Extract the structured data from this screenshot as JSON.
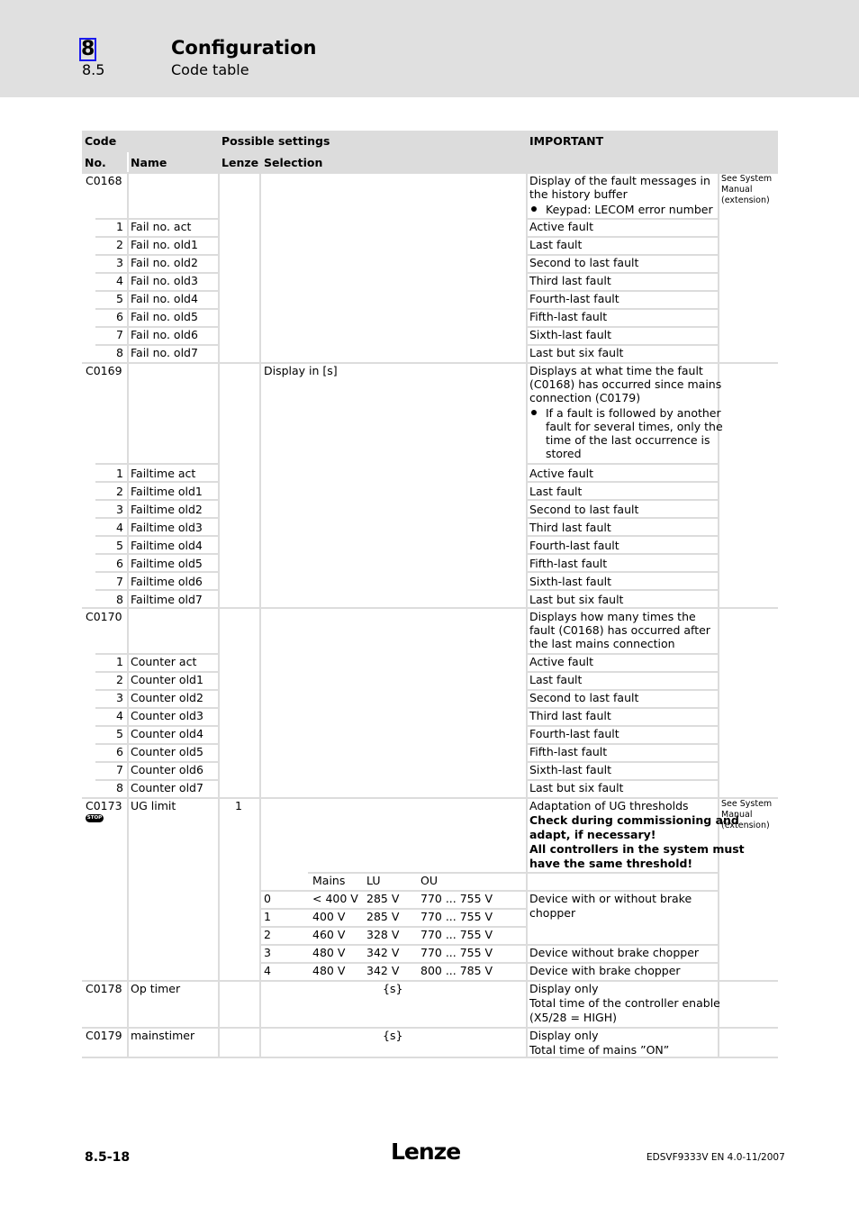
{
  "header": {
    "chapter_number": "8",
    "chapter_title": "Configuration",
    "section_number": "8.5",
    "section_title": "Code table"
  },
  "table": {
    "headers": {
      "code": "Code",
      "possible_settings": "Possible settings",
      "important": "IMPORTANT",
      "no": "No.",
      "name": "Name",
      "lenze": "Lenze",
      "selection": "Selection"
    },
    "see_system_manual": "See System Manual (extension)",
    "see_lines": [
      "See System",
      "Manual",
      "(extension)"
    ],
    "fault_labels": [
      "Active fault",
      "Last fault",
      "Second to last fault",
      "Third last fault",
      "Fourth-last fault",
      "Fifth-last fault",
      "Sixth-last fault",
      "Last but six fault"
    ],
    "c0168": {
      "code": "C0168",
      "desc_lines": [
        "Display of the fault messages in",
        "the history buffer"
      ],
      "bullet": "Keypad: LECOM error number",
      "subcodes": [
        {
          "no": "1",
          "name": "Fail no. act"
        },
        {
          "no": "2",
          "name": "Fail no. old1"
        },
        {
          "no": "3",
          "name": "Fail no. old2"
        },
        {
          "no": "4",
          "name": "Fail no. old3"
        },
        {
          "no": "5",
          "name": "Fail no. old4"
        },
        {
          "no": "6",
          "name": "Fail no. old5"
        },
        {
          "no": "7",
          "name": "Fail no. old6"
        },
        {
          "no": "8",
          "name": "Fail no. old7"
        }
      ]
    },
    "c0169": {
      "code": "C0169",
      "selection": "Display in [s]",
      "desc_lines": [
        "Displays at what time the fault",
        "(C0168) has occurred since mains",
        "connection (C0179)"
      ],
      "bullet_lines": [
        "If a fault is followed by another",
        "fault for several times, only the",
        "time of the last occurrence is",
        "stored"
      ],
      "subcodes": [
        {
          "no": "1",
          "name": "Failtime act"
        },
        {
          "no": "2",
          "name": "Failtime old1"
        },
        {
          "no": "3",
          "name": "Failtime old2"
        },
        {
          "no": "4",
          "name": "Failtime old3"
        },
        {
          "no": "5",
          "name": "Failtime old4"
        },
        {
          "no": "6",
          "name": "Failtime old5"
        },
        {
          "no": "7",
          "name": "Failtime old6"
        },
        {
          "no": "8",
          "name": "Failtime old7"
        }
      ]
    },
    "c0170": {
      "code": "C0170",
      "desc_lines": [
        "Displays how many times the",
        "fault (C0168) has occurred after",
        "the last mains connection"
      ],
      "subcodes": [
        {
          "no": "1",
          "name": "Counter act"
        },
        {
          "no": "2",
          "name": "Counter old1"
        },
        {
          "no": "3",
          "name": "Counter old2"
        },
        {
          "no": "4",
          "name": "Counter old3"
        },
        {
          "no": "5",
          "name": "Counter old4"
        },
        {
          "no": "6",
          "name": "Counter old5"
        },
        {
          "no": "7",
          "name": "Counter old6"
        },
        {
          "no": "8",
          "name": "Counter old7"
        }
      ]
    },
    "c0173": {
      "code": "C0173",
      "stop_badge": "STOP",
      "name": "UG limit",
      "lenze": "1",
      "desc": "Adaptation of UG thresholds",
      "bold_lines": [
        "Check during commissioning and",
        "adapt, if necessary!",
        "All controllers in the system must",
        "have the same threshold!"
      ],
      "columns": [
        "Mains",
        "LU",
        "OU"
      ],
      "rows": [
        {
          "sel": "0",
          "mains": "< 400 V",
          "lu": "285 V",
          "ou": "770 ... 755 V"
        },
        {
          "sel": "1",
          "mains": "400 V",
          "lu": "285 V",
          "ou": "770 ... 755 V"
        },
        {
          "sel": "2",
          "mains": "460 V",
          "lu": "328 V",
          "ou": "770 ... 755 V"
        },
        {
          "sel": "3",
          "mains": "480 V",
          "lu": "342 V",
          "ou": "770 ... 755 V"
        },
        {
          "sel": "4",
          "mains": "480 V",
          "lu": "342 V",
          "ou": "800 ... 785 V"
        }
      ],
      "notes": [
        "Device with or without brake",
        "chopper",
        "Device without brake chopper",
        "Device with brake chopper"
      ]
    },
    "c0178": {
      "code": "C0178",
      "name": "Op timer",
      "selection": "{s}",
      "desc_lines": [
        "Display only",
        "Total time of the controller enable",
        "(X5/28 = HIGH)"
      ]
    },
    "c0179": {
      "code": "C0179",
      "name": "mainstimer",
      "selection": "{s}",
      "desc_lines": [
        "Display only",
        "Total time of mains ”ON”"
      ]
    }
  },
  "footer": {
    "page": "8.5-18",
    "logo": "Lenze",
    "doc_id": "EDSVF9333V  EN  4.0-11/2007"
  }
}
